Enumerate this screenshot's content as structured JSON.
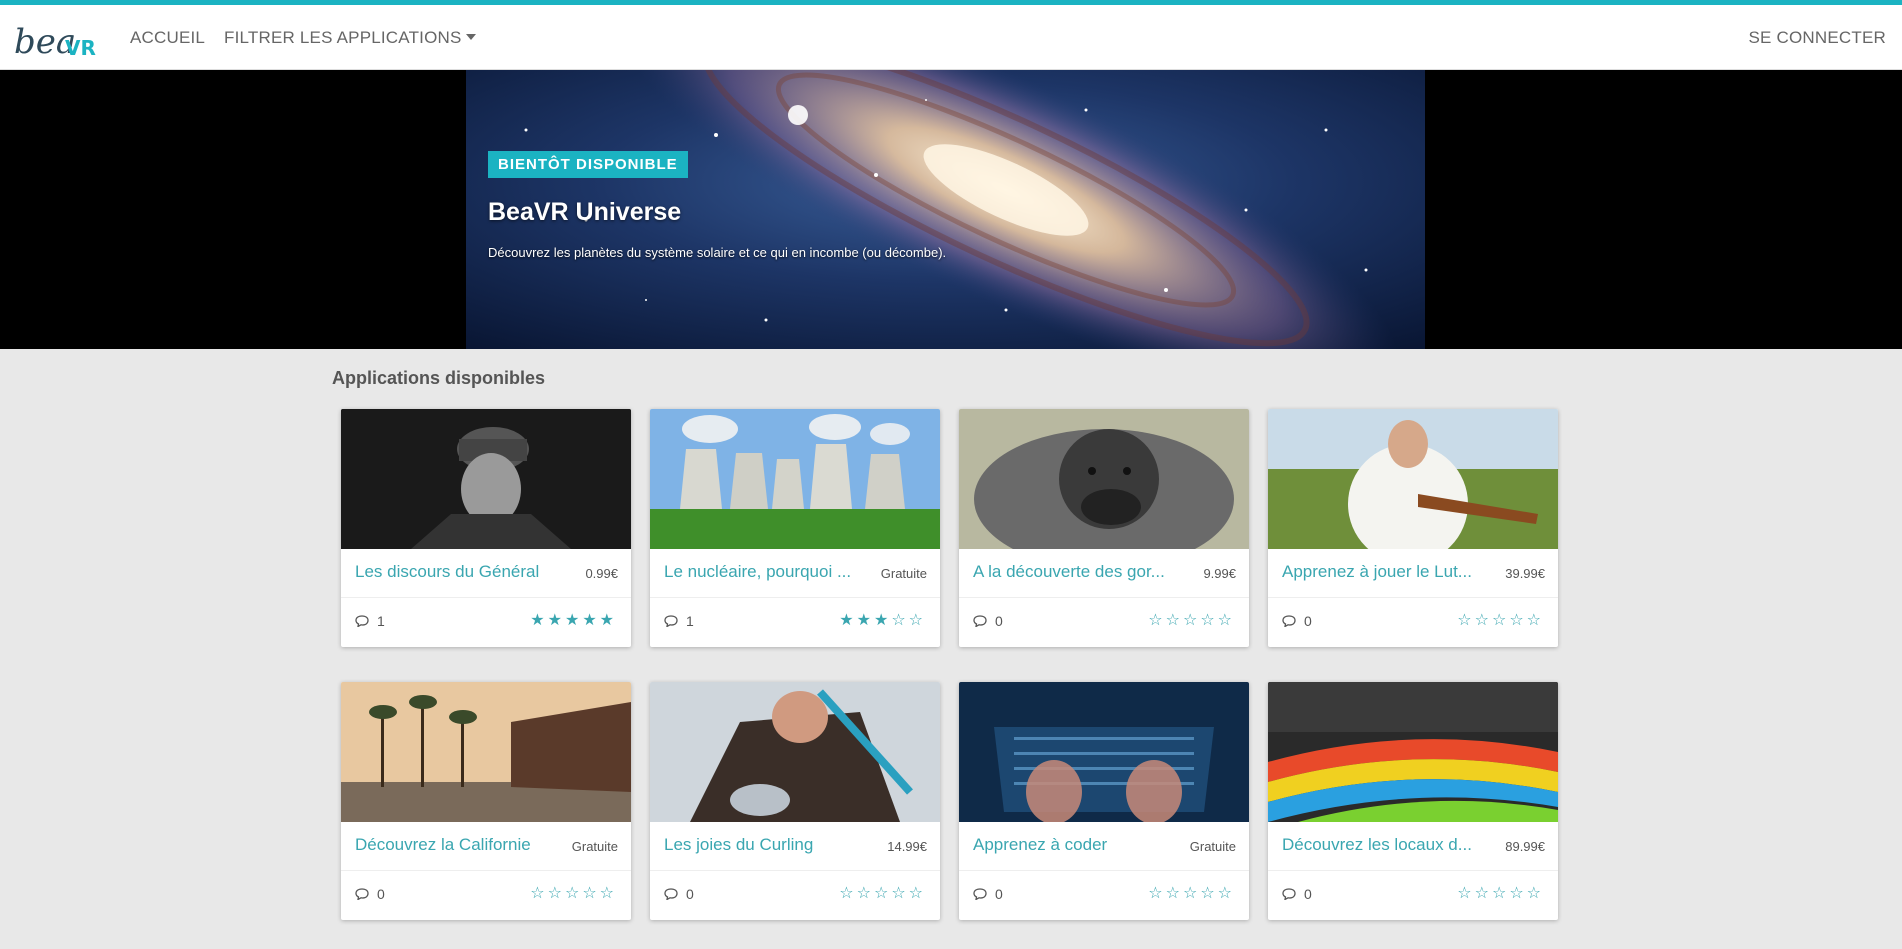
{
  "brand": {
    "logo_alt": "beaVR",
    "accent": "#1bb3c2"
  },
  "nav": {
    "home": "ACCUEIL",
    "filter": "FILTRER LES APPLICATIONS",
    "login": "SE CONNECTER"
  },
  "hero": {
    "badge": "BIENTÔT DISPONIBLE",
    "title": "BeaVR Universe",
    "description": "Découvrez les planètes du système solaire et ce qui en incombe (ou décombe)."
  },
  "section": {
    "title": "Applications disponibles"
  },
  "apps": [
    {
      "title": "Les discours du Général",
      "price": "0.99€",
      "comments": "1",
      "rating": 5,
      "stars": "★★★★★"
    },
    {
      "title": "Le nucléaire, pourquoi ...",
      "price": "Gratuite",
      "comments": "1",
      "rating": 3,
      "stars": "★★★☆☆"
    },
    {
      "title": "A la découverte des gor...",
      "price": "9.99€",
      "comments": "0",
      "rating": 0,
      "stars": "☆☆☆☆☆"
    },
    {
      "title": "Apprenez à jouer le Lut...",
      "price": "39.99€",
      "comments": "0",
      "rating": 0,
      "stars": "☆☆☆☆☆"
    },
    {
      "title": "Découvrez la Californie",
      "price": "Gratuite",
      "comments": "0",
      "rating": 0,
      "stars": "☆☆☆☆☆"
    },
    {
      "title": "Les joies du Curling",
      "price": "14.99€",
      "comments": "0",
      "rating": 0,
      "stars": "☆☆☆☆☆"
    },
    {
      "title": "Apprenez à coder",
      "price": "Gratuite",
      "comments": "0",
      "rating": 0,
      "stars": "☆☆☆☆☆"
    },
    {
      "title": "Découvrez les locaux d...",
      "price": "89.99€",
      "comments": "0",
      "rating": 0,
      "stars": "☆☆☆☆☆"
    }
  ]
}
